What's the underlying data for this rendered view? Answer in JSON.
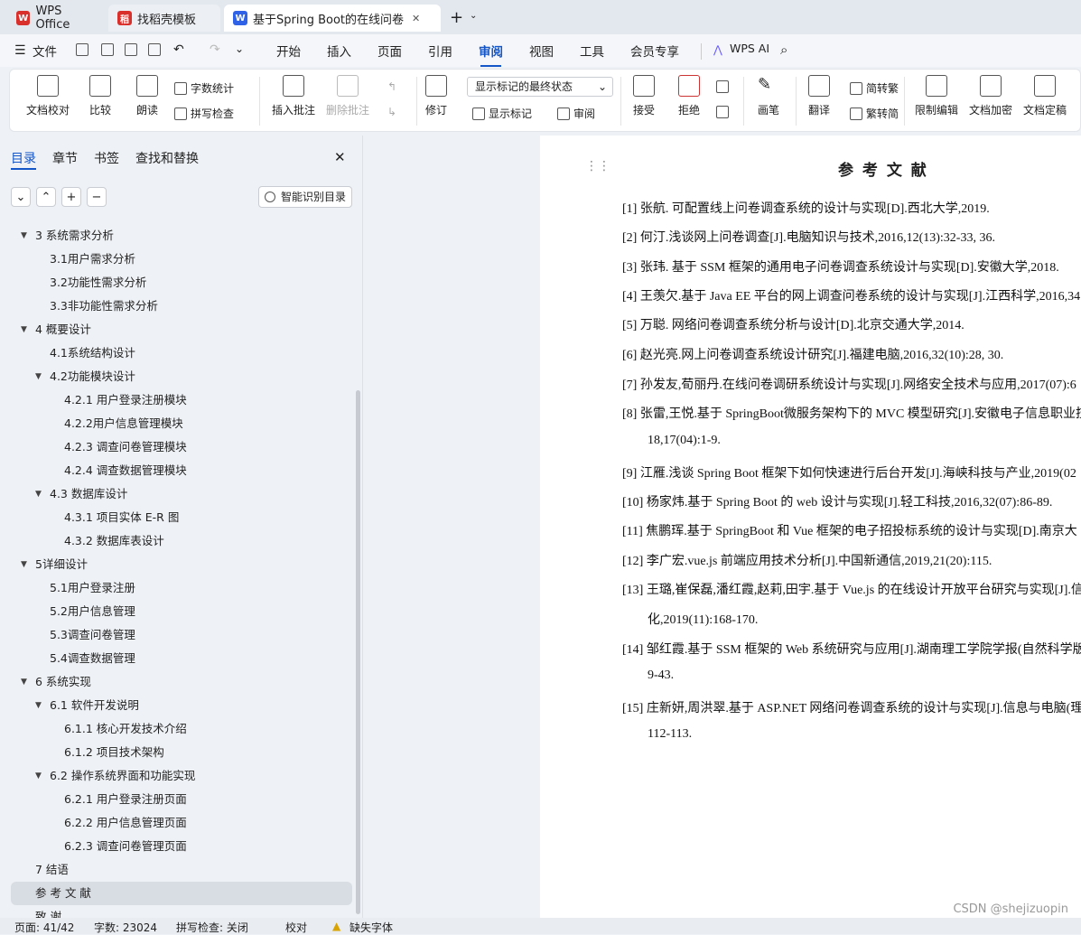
{
  "tabs": [
    {
      "label": "WPS Office",
      "logo": "W",
      "color": "#d9302c"
    },
    {
      "label": "找稻壳模板",
      "logo": "稻",
      "color": "#d9302c"
    },
    {
      "label": "基于Spring Boot的在线问卷",
      "logo": "W",
      "color": "#2f62e6"
    }
  ],
  "menu": {
    "file": "文件",
    "items": [
      "开始",
      "插入",
      "页面",
      "引用",
      "审阅",
      "视图",
      "工具",
      "会员专享"
    ],
    "active": "审阅",
    "wps_ai": "WPS AI"
  },
  "ribbon": {
    "doc_check": "文档校对",
    "compare": "比较",
    "read_aloud": "朗读",
    "word_count": "字数统计",
    "spell_check": "拼写检查",
    "insert_comment": "插入批注",
    "delete_comment": "删除批注",
    "revise": "修订",
    "markup_state": "显示标记的最终状态",
    "show_markup": "显示标记",
    "review": "审阅",
    "accept": "接受",
    "reject": "拒绝",
    "pen": "画笔",
    "translate": "翻译",
    "to_trad": "简转繁",
    "to_simp": "繁转简",
    "restrict": "限制编辑",
    "encrypt": "文档加密",
    "finalize": "文档定稿"
  },
  "sidebar": {
    "tabs": [
      "目录",
      "章节",
      "书签",
      "查找和替换"
    ],
    "smart_toc": "智能识别目录",
    "toc": [
      {
        "label": "3  系统需求分析",
        "level": 0
      },
      {
        "label": "3.1用户需求分析",
        "level": 1
      },
      {
        "label": "3.2功能性需求分析",
        "level": 1
      },
      {
        "label": "3.3非功能性需求分析",
        "level": 1
      },
      {
        "label": "4  概要设计",
        "level": 0
      },
      {
        "label": "4.1系统结构设计",
        "level": 1
      },
      {
        "label": "4.2功能模块设计",
        "level": 1
      },
      {
        "label": "4.2.1 用户登录注册模块",
        "level": 2
      },
      {
        "label": "4.2.2用户信息管理模块",
        "level": 2
      },
      {
        "label": "4.2.3 调查问卷管理模块",
        "level": 2
      },
      {
        "label": "4.2.4 调查数据管理模块",
        "level": 2
      },
      {
        "label": "4.3  数据库设计",
        "level": 1
      },
      {
        "label": "4.3.1  项目实体 E-R 图",
        "level": 2
      },
      {
        "label": "4.3.2  数据库表设计",
        "level": 2
      },
      {
        "label": "5详细设计",
        "level": 0
      },
      {
        "label": "5.1用户登录注册",
        "level": 1
      },
      {
        "label": "5.2用户信息管理",
        "level": 1
      },
      {
        "label": "5.3调查问卷管理",
        "level": 1
      },
      {
        "label": "5.4调查数据管理",
        "level": 1
      },
      {
        "label": "6  系统实现",
        "level": 0
      },
      {
        "label": "6.1  软件开发说明",
        "level": 1
      },
      {
        "label": "6.1.1  核心开发技术介绍",
        "level": 2
      },
      {
        "label": "6.1.2  项目技术架构",
        "level": 2
      },
      {
        "label": "6.2  操作系统界面和功能实现",
        "level": 1
      },
      {
        "label": "6.2.1  用户登录注册页面",
        "level": 2
      },
      {
        "label": "6.2.2  用户信息管理页面",
        "level": 2
      },
      {
        "label": "6.2.3  调查问卷管理页面",
        "level": 2
      },
      {
        "label": "7  结语",
        "level": 0
      },
      {
        "label": "参  考  文  献",
        "level": 0
      },
      {
        "label": "致          谢",
        "level": 0
      }
    ]
  },
  "document": {
    "heading": "参 考 文 献",
    "refs": [
      "[1] 张航.  可配置线上问卷调查系统的设计与实现[D].西北大学,2019.",
      "[2]  何汀.浅谈网上问卷调查[J].电脑知识与技术,2016,12(13):32-33,  36.",
      "[3]  张玮.  基于 SSM 框架的通用电子问卷调查系统设计与实现[D].安徽大学,2018.",
      "[4]  王羡欠.基于 Java  EE 平台的网上调查问卷系统的设计与实现[J].江西科学,2016,34",
      "[5]  万聪.  网络问卷调查系统分析与设计[D].北京交通大学,2014.",
      "[6]  赵光亮.网上问卷调查系统设计研究[J].福建电脑,2016,32(10):28,  30.",
      "[7]   孙发友,荀丽丹.在线问卷调研系统设计与实现[J].网络安全技术与应用,2017(07):6",
      "[8]  张雷,王悦.基于 SpringBoot微服务架构下的 MVC 模型研究[J].安徽电子信息职业技",
      "18,17(04):1-9.",
      "[9]  江雁.浅谈 Spring  Boot 框架下如何快速进行后台开发[J].海峡科技与产业,2019(02",
      "[10]  杨家炜.基于 Spring  Boot 的 web 设计与实现[J].轻工科技,2016,32(07):86-89.",
      "[11]  焦鹏珲.基于 SpringBoot 和 Vue 框架的电子招投标系统的设计与实现[D].南京大",
      "[12]  李广宏.vue.js 前端应用技术分析[J].中国新通信,2019,21(20):115.",
      "[13]  王璐,崔保磊,潘红霞,赵莉,田宇.基于 Vue.js 的在线设计开放平台研究与实现[J].信",
      "化,2019(11):168-170.",
      "[14]  邹红霞.基于 SSM 框架的 Web 系统研究与应用[J].湖南理工学院学报(自然科学版",
      "9-43.",
      "[15]  庄新妍,周洪翠.基于 ASP.NET 网络问卷调查系统的设计与实现[J].信息与电脑(理",
      "112-113."
    ]
  },
  "status": {
    "page": "页面: 41/42",
    "words": "字数: 23024",
    "spell": "拼写检查: 关闭",
    "proof": "校对",
    "missing_font": "缺失字体"
  },
  "watermark": "CSDN @shejizuopin"
}
